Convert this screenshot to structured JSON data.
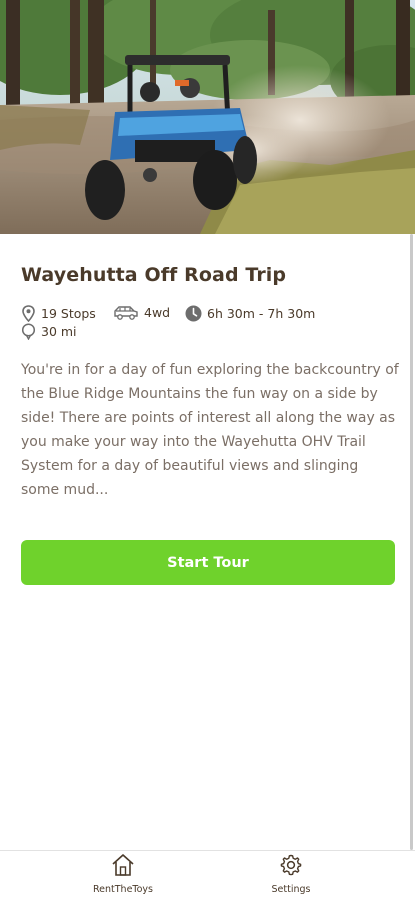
{
  "tour": {
    "title": "Wayehutta Off Road Trip",
    "stops": "19 Stops",
    "vehicle": "4wd",
    "duration": "6h 30m - 7h 30m",
    "distance": "30 mi",
    "description": "You're in for a day of fun exploring the backcountry of the Blue Ridge Mountains the fun way on a side by side! There are points of interest all along the way as you make your way into the Wayehutta OHV Trail System for a day of beautiful views and slinging some mud..."
  },
  "actions": {
    "start_label": "Start Tour"
  },
  "tabbar": {
    "items": [
      {
        "label": "RentTheToys",
        "icon": "home-icon"
      },
      {
        "label": "Settings",
        "icon": "gear-icon"
      }
    ]
  },
  "colors": {
    "accent": "#6fd22c",
    "text_dark": "#4a3a2a",
    "text_body": "#7b6f66"
  }
}
